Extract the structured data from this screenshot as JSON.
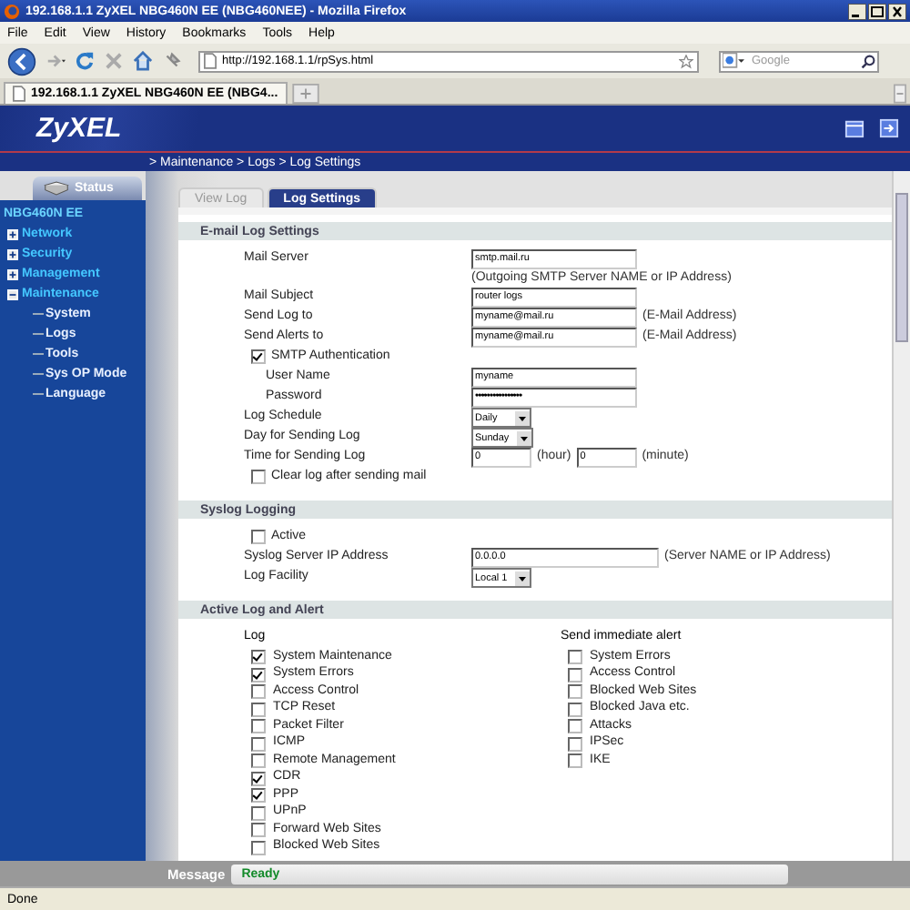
{
  "window": {
    "title": "192.168.1.1 ZyXEL NBG460N EE (NBG460NEE) - Mozilla Firefox"
  },
  "menu": [
    "File",
    "Edit",
    "View",
    "History",
    "Bookmarks",
    "Tools",
    "Help"
  ],
  "toolbar": {
    "url": "http://192.168.1.1/rpSys.html",
    "search_placeholder": "Google"
  },
  "browser_tabs": [
    {
      "label": "192.168.1.1 ZyXEL NBG460N EE (NBG4...",
      "selected": true
    }
  ],
  "router": {
    "logo": "ZyXEL",
    "breadcrumb": "> Maintenance > Logs > Log Settings",
    "status_tab": "Status",
    "device": "NBG460N EE",
    "nav": [
      {
        "label": "Network",
        "expanded": false
      },
      {
        "label": "Security",
        "expanded": false
      },
      {
        "label": "Management",
        "expanded": false
      },
      {
        "label": "Maintenance",
        "expanded": true,
        "children": [
          "System",
          "Logs",
          "Tools",
          "Sys OP Mode",
          "Language"
        ]
      }
    ]
  },
  "page_tabs": [
    {
      "label": "View Log",
      "selected": false
    },
    {
      "label": "Log Settings",
      "selected": true
    }
  ],
  "email": {
    "heading": "E-mail Log Settings",
    "rows": [
      {
        "kind": "text",
        "label": "Mail Server",
        "value": "smtp.mail.ru",
        "hint": "(Outgoing SMTP Server NAME or IP Address)"
      },
      {
        "kind": "text",
        "label": "Mail Subject",
        "value": "router logs"
      },
      {
        "kind": "text",
        "label": "Send Log to",
        "value": "myname@mail.ru",
        "hint": "(E-Mail Address)"
      },
      {
        "kind": "text",
        "label": "Send Alerts to",
        "value": "myname@mail.ru",
        "hint": "(E-Mail Address)"
      },
      {
        "kind": "checkbox",
        "label": "SMTP Authentication",
        "checked": true,
        "children": [
          {
            "kind": "text",
            "label": "User Name",
            "value": "myname"
          },
          {
            "kind": "password",
            "label": "Password",
            "value": "••••••••••••••••"
          }
        ]
      },
      {
        "kind": "select",
        "label": "Log Schedule",
        "value": "Daily"
      },
      {
        "kind": "select",
        "label": "Day for Sending Log",
        "value": "Sunday"
      },
      {
        "kind": "time",
        "label": "Time for Sending Log",
        "parts": [
          {
            "value": "0",
            "unit": "(hour)"
          },
          {
            "value": "0",
            "unit": "(minute)"
          }
        ]
      },
      {
        "kind": "checkbox",
        "label": "Clear log after sending mail",
        "checked": false,
        "children": []
      }
    ]
  },
  "syslog": {
    "heading": "Syslog Logging",
    "rows": [
      {
        "kind": "checkbox",
        "label": "Active",
        "checked": false,
        "children": []
      },
      {
        "kind": "text",
        "label": "Syslog Server IP Address",
        "value": "0.0.0.0",
        "hint": "(Server NAME or IP Address)"
      },
      {
        "kind": "select",
        "label": "Log Facility",
        "value": "Local 1"
      }
    ]
  },
  "active_log": {
    "heading": "Active Log and Alert",
    "log_heading": "Log",
    "alert_heading": "Send immediate alert",
    "log": [
      {
        "label": "System Maintenance",
        "checked": true
      },
      {
        "label": "System Errors",
        "checked": true
      },
      {
        "label": "Access Control",
        "checked": false
      },
      {
        "label": "TCP Reset",
        "checked": false
      },
      {
        "label": "Packet Filter",
        "checked": false
      },
      {
        "label": "ICMP",
        "checked": false
      },
      {
        "label": "Remote Management",
        "checked": false
      },
      {
        "label": "CDR",
        "checked": true
      },
      {
        "label": "PPP",
        "checked": true
      },
      {
        "label": "UPnP",
        "checked": false
      },
      {
        "label": "Forward Web Sites",
        "checked": false
      },
      {
        "label": "Blocked Web Sites",
        "checked": false
      }
    ],
    "alerts": [
      {
        "label": "System Errors",
        "checked": false
      },
      {
        "label": "Access Control",
        "checked": false
      },
      {
        "label": "Blocked Web Sites",
        "checked": false
      },
      {
        "label": "Blocked Java etc.",
        "checked": false
      },
      {
        "label": "Attacks",
        "checked": false
      },
      {
        "label": "IPSec",
        "checked": false
      },
      {
        "label": "IKE",
        "checked": false
      }
    ]
  },
  "message": {
    "label": "Message",
    "value": "Ready"
  },
  "status_bar": "Done"
}
